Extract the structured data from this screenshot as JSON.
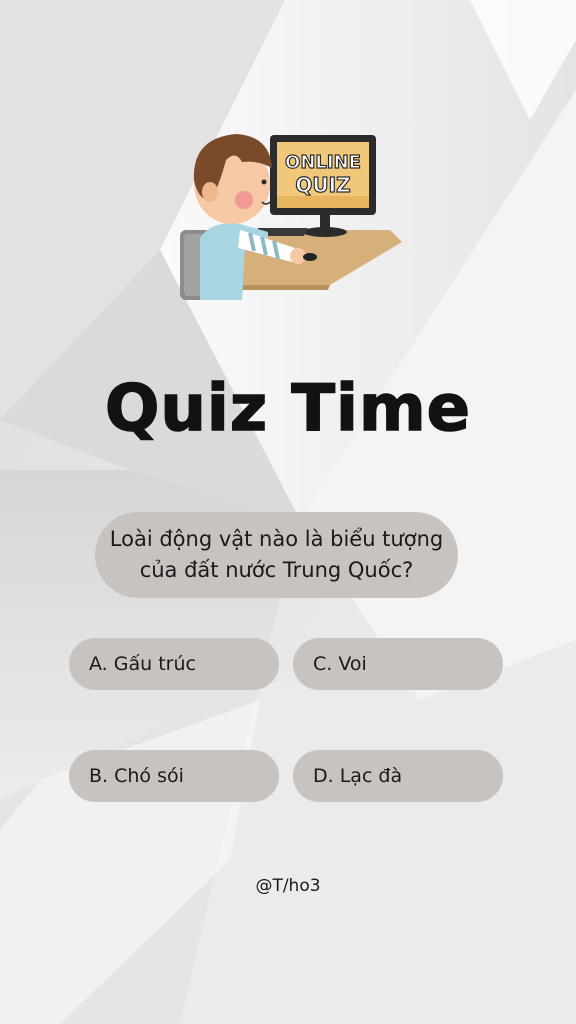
{
  "illustration": {
    "icon": "online-quiz-illustration",
    "screen_line1": "ONLINE",
    "screen_line2": "QUIZ"
  },
  "title": "Quiz Time",
  "question": "Loài động vật nào là biểu tượng\ncủa đất nước Trung Quốc?",
  "options": [
    {
      "label": "A. Gấu trúc"
    },
    {
      "label": "C. Voi"
    },
    {
      "label": "B. Chó sói"
    },
    {
      "label": "D. Lạc đà"
    }
  ],
  "handle": "@T/ho3",
  "colors": {
    "pill": "#c9c3c0",
    "background": "#e9e9e9",
    "text": "#121212"
  }
}
